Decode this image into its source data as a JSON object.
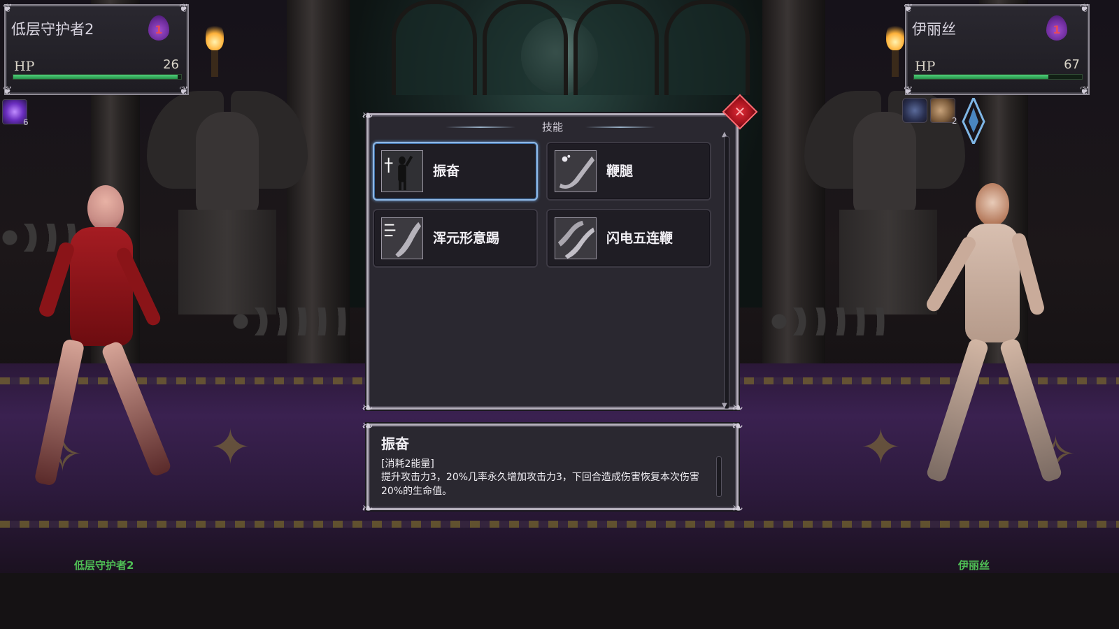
{
  "enemy": {
    "name": "低层守护者2",
    "energy": "1",
    "hp_label": "HP",
    "hp_value": "26",
    "hp_fraction": 0.98,
    "status_count": "6",
    "floor_name": "低层守护者2"
  },
  "player": {
    "name": "伊丽丝",
    "energy": "1",
    "hp_label": "HP",
    "hp_value": "67",
    "hp_fraction": 0.8,
    "buff_count": "2",
    "floor_name": "伊丽丝"
  },
  "skills_window": {
    "title": "技能",
    "close_symbol": "✕",
    "skills": [
      {
        "label": "振奋",
        "icon": "figure-raise-icon",
        "selected": true
      },
      {
        "label": "鞭腿",
        "icon": "leg-whip-icon",
        "selected": false
      },
      {
        "label": "浑元形意踢",
        "icon": "leg-kick-speed-icon",
        "selected": false
      },
      {
        "label": "闪电五连鞭",
        "icon": "double-leg-whip-icon",
        "selected": false
      }
    ]
  },
  "description": {
    "title": "振奋",
    "cost": "[消耗2能量]",
    "text": "提升攻击力3，20%几率永久增加攻击力3，下回合造成伤害恢复本次伤害20%的生命值。"
  },
  "colors": {
    "hp_green": "#3cb861",
    "selected_border": "#8fb8e6",
    "close_red": "#c4161f",
    "name_green": "#4fbf55"
  }
}
